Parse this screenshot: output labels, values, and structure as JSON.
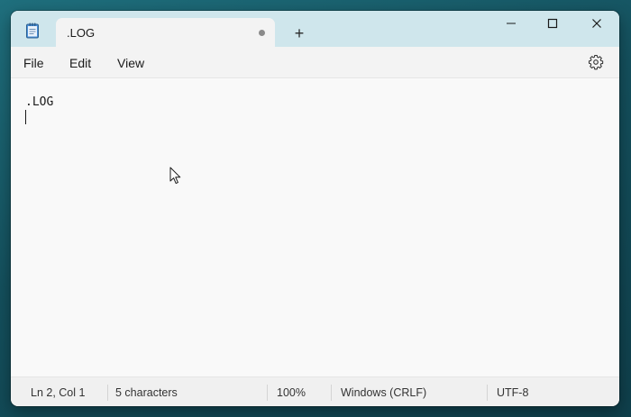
{
  "tab": {
    "title": ".LOG",
    "new_tab_glyph": "+"
  },
  "menu": {
    "file": "File",
    "edit": "Edit",
    "view": "View"
  },
  "editor": {
    "lines": [
      ".LOG"
    ]
  },
  "status": {
    "position": "Ln 2, Col 1",
    "characters": "5 characters",
    "zoom": "100%",
    "line_ending": "Windows (CRLF)",
    "encoding": "UTF-8"
  },
  "icons": {
    "app": "notepad-icon",
    "unsaved": "unsaved-dot-icon",
    "settings": "gear-icon",
    "minimize": "minimize-icon",
    "maximize": "maximize-icon",
    "close": "close-icon"
  },
  "colors": {
    "titlebar": "#cfe6ec",
    "window": "#f9f9f9",
    "accent": "#2b6cb0"
  }
}
